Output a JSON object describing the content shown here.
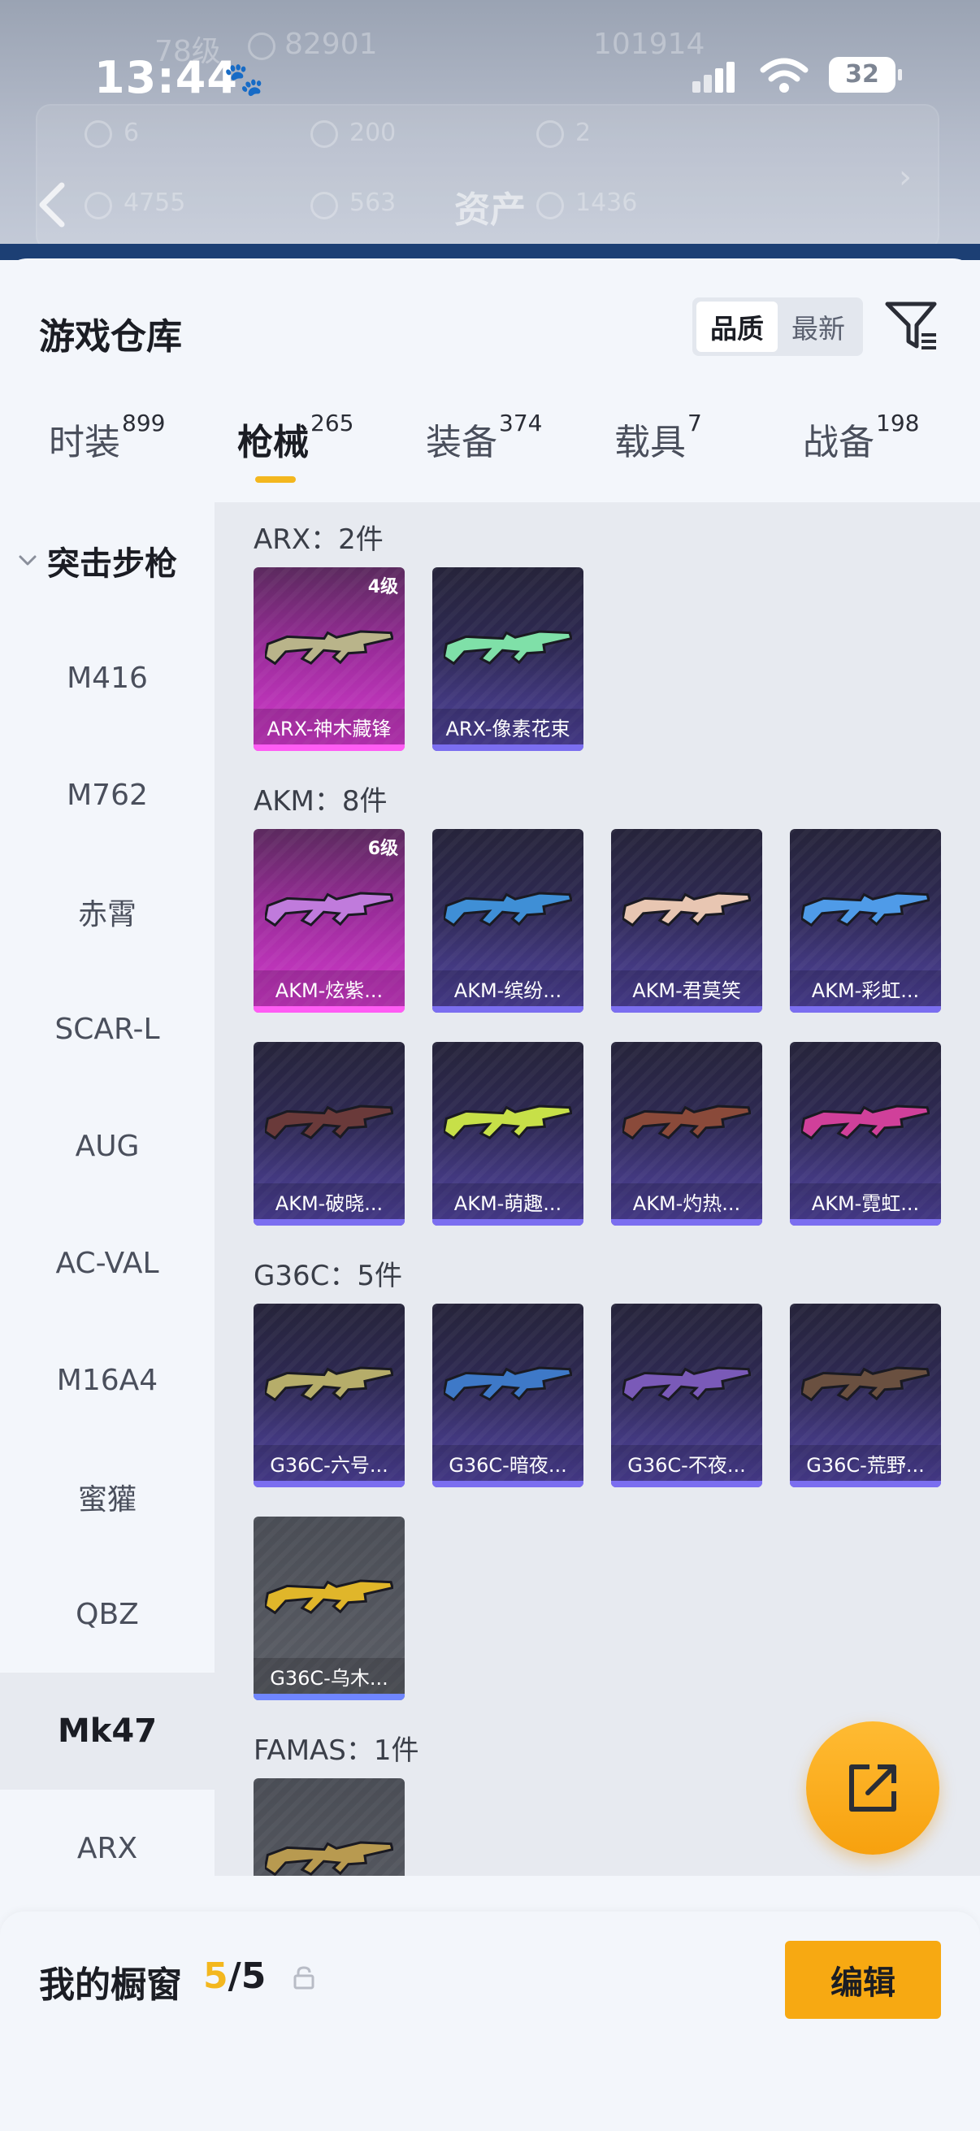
{
  "status_bar": {
    "time": "13:44",
    "battery": "32"
  },
  "background_header": {
    "title": "资产",
    "faint_texts": [
      "78级",
      "82901",
      "101914",
      "6",
      "200",
      "2",
      "4755",
      "563",
      "1436"
    ]
  },
  "warehouse": {
    "title": "游戏仓库",
    "sort_options": [
      {
        "label": "品质",
        "active": true
      },
      {
        "label": "最新",
        "active": false
      }
    ]
  },
  "tabs": [
    {
      "label": "时装",
      "count": "899",
      "active": false
    },
    {
      "label": "枪械",
      "count": "265",
      "active": true
    },
    {
      "label": "装备",
      "count": "374",
      "active": false
    },
    {
      "label": "载具",
      "count": "7",
      "active": false
    },
    {
      "label": "战备",
      "count": "198",
      "active": false
    }
  ],
  "sidebar": {
    "category": "突击步枪",
    "items": [
      {
        "label": "M416",
        "active": false
      },
      {
        "label": "M762",
        "active": false
      },
      {
        "label": "赤霄",
        "active": false
      },
      {
        "label": "SCAR-L",
        "active": false
      },
      {
        "label": "AUG",
        "active": false
      },
      {
        "label": "AC-VAL",
        "active": false
      },
      {
        "label": "M16A4",
        "active": false
      },
      {
        "label": "蜜獾",
        "active": false
      },
      {
        "label": "QBZ",
        "active": false
      },
      {
        "label": "Mk47",
        "active": true
      },
      {
        "label": "ARX",
        "active": false
      }
    ]
  },
  "groups": [
    {
      "title": "ARX：2件",
      "items": [
        {
          "name": "ARX-神木藏锋",
          "level": "4级",
          "rarity": "pink",
          "color": "#b9b48a"
        },
        {
          "name": "ARX-像素花束",
          "level": "",
          "rarity": "purple",
          "color": "#7fe0a8"
        }
      ]
    },
    {
      "title": "AKM：8件",
      "items": [
        {
          "name": "AKM-炫紫...",
          "level": "6级",
          "rarity": "pink",
          "color": "#c07bdc"
        },
        {
          "name": "AKM-缤纷...",
          "level": "",
          "rarity": "purple",
          "color": "#3f8fd6"
        },
        {
          "name": "AKM-君莫笑",
          "level": "",
          "rarity": "purple",
          "color": "#e8c6b2"
        },
        {
          "name": "AKM-彩虹...",
          "level": "",
          "rarity": "purple",
          "color": "#4f9be8"
        },
        {
          "name": "AKM-破晓...",
          "level": "",
          "rarity": "purple",
          "color": "#6a3a3a"
        },
        {
          "name": "AKM-萌趣...",
          "level": "",
          "rarity": "purple",
          "color": "#c7e048"
        },
        {
          "name": "AKM-灼热...",
          "level": "",
          "rarity": "purple",
          "color": "#8a4a3a"
        },
        {
          "name": "AKM-霓虹...",
          "level": "",
          "rarity": "purple",
          "color": "#d0409a"
        }
      ]
    },
    {
      "title": "G36C：5件",
      "items": [
        {
          "name": "G36C-六号...",
          "level": "",
          "rarity": "purple",
          "color": "#b6ad6a"
        },
        {
          "name": "G36C-暗夜...",
          "level": "",
          "rarity": "purple",
          "color": "#3e79c8"
        },
        {
          "name": "G36C-不夜...",
          "level": "",
          "rarity": "purple",
          "color": "#7a5ab8"
        },
        {
          "name": "G36C-荒野...",
          "level": "",
          "rarity": "purple",
          "color": "#6a5040"
        },
        {
          "name": "G36C-乌木...",
          "level": "",
          "rarity": "grey",
          "color": "#e0b62a"
        }
      ]
    },
    {
      "title": "FAMAS：1件",
      "items": [
        {
          "name": "",
          "level": "",
          "rarity": "grey",
          "color": "#b89a50"
        }
      ]
    }
  ],
  "showcase": {
    "label": "我的橱窗",
    "count_current": "5",
    "count_total": "/5",
    "edit_label": "编辑"
  }
}
